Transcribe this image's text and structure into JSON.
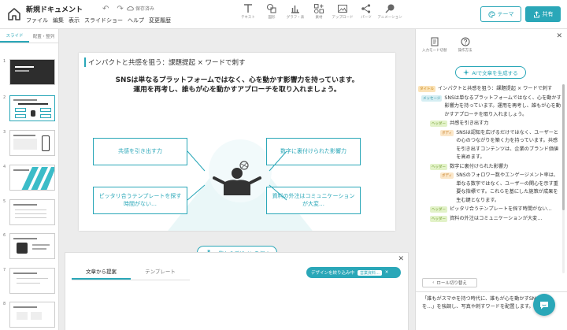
{
  "header": {
    "doc_title": "新規ドキュメント",
    "menu": [
      "ファイル",
      "編集",
      "表示",
      "スライドショー",
      "ヘルプ",
      "変更履歴"
    ],
    "save_status": "保存済み",
    "tools": [
      {
        "label": "テキスト",
        "icon": "text-icon"
      },
      {
        "label": "図形",
        "icon": "shape-icon"
      },
      {
        "label": "グラフ・表",
        "icon": "chart-icon"
      },
      {
        "label": "素材",
        "icon": "material-icon"
      },
      {
        "label": "アップロード",
        "icon": "upload-icon"
      },
      {
        "label": "パーツ",
        "icon": "parts-icon"
      },
      {
        "label": "アニメーション",
        "icon": "animation-icon"
      }
    ],
    "theme_label": "テーマ",
    "share_label": "共有"
  },
  "left_sidebar": {
    "tabs": [
      "スライド",
      "配置・整列"
    ],
    "active_tab": 0,
    "slides": [
      {
        "num": "1"
      },
      {
        "num": "2"
      },
      {
        "num": "3"
      },
      {
        "num": "4"
      },
      {
        "num": "5"
      },
      {
        "num": "6"
      },
      {
        "num": "7"
      },
      {
        "num": "8"
      }
    ],
    "selected_slide": 2
  },
  "slide": {
    "title": "インパクトと共感を狙う：課題提起 × ワードで刺す",
    "message_line1": "SNSは単なるプラットフォームではなく、心を動かす影響力を持っています。",
    "message_line2": "運用を再考し、誰もが心を動かすアプローチを取り入れましょう。",
    "points": [
      "共感を引き出す力",
      "数字に裏付けられた影響力",
      "ピッタリ合うテンプレートを探す時間がない…",
      "資料の外注はコミュニケーションが大変…"
    ]
  },
  "canvas": {
    "design_button": "一覧からデザインを探す"
  },
  "bottom_panel": {
    "tabs": [
      "文章から提案",
      "テンプレート"
    ],
    "active_tab": 0,
    "filter_label": "デザインを絞り込み中",
    "filter_chip": "営業資料..."
  },
  "right_panel": {
    "icons": [
      {
        "label": "入力モード切替",
        "icon": "input-mode-icon"
      },
      {
        "label": "操作方法",
        "icon": "help-icon"
      }
    ],
    "ai_button": "AIで文章を生成する",
    "outline": [
      {
        "tag": "タイトル",
        "kind": "title",
        "indent": 0,
        "text": "インパクトと共感を狙う：課題提起 × ワードで刺す"
      },
      {
        "tag": "メッセージ",
        "kind": "msg",
        "indent": 0,
        "text": "SNSは単なるプラットフォームではなく、心を動かす影響力を持っています。運用を再考し、誰もが心を動かすアプローチを取り入れましょう。"
      },
      {
        "tag": "ヘッダー",
        "kind": "head",
        "indent": 1,
        "text": "共感を引き出す力"
      },
      {
        "tag": "ボディ",
        "kind": "body",
        "indent": 2,
        "text": "SNSは認知を広げるだけではなく、ユーザーとの心のつながりを築く力を持っています。共感を引き出すコンテンツは、企業のブランド価値を高めます。"
      },
      {
        "tag": "ヘッダー",
        "kind": "head",
        "indent": 1,
        "text": "数字に裏付けられた影響力"
      },
      {
        "tag": "ボディ",
        "kind": "body",
        "indent": 2,
        "text": "SNSのフォロワー数やエンゲージメント率は、単なる数字ではなく、ユーザーの関心を示す重要な指標です。これらを基にした施策が成果を生む鍵となります。"
      },
      {
        "tag": "ヘッダー",
        "kind": "head",
        "indent": 1,
        "text": "ピッタリ合うテンプレートを探す時間がない…"
      },
      {
        "tag": "ヘッダー",
        "kind": "head",
        "indent": 1,
        "text": "資料の外注はコミュニケーションが大変…"
      }
    ],
    "roll_button": "ロール切り替え",
    "footer_text": "「誰もがスマホを持つ時代に、誰もが心を動かすSNSを…」を強調し、写真や刺すワードを配置します。"
  },
  "colors": {
    "accent": "#2aa7b8"
  }
}
